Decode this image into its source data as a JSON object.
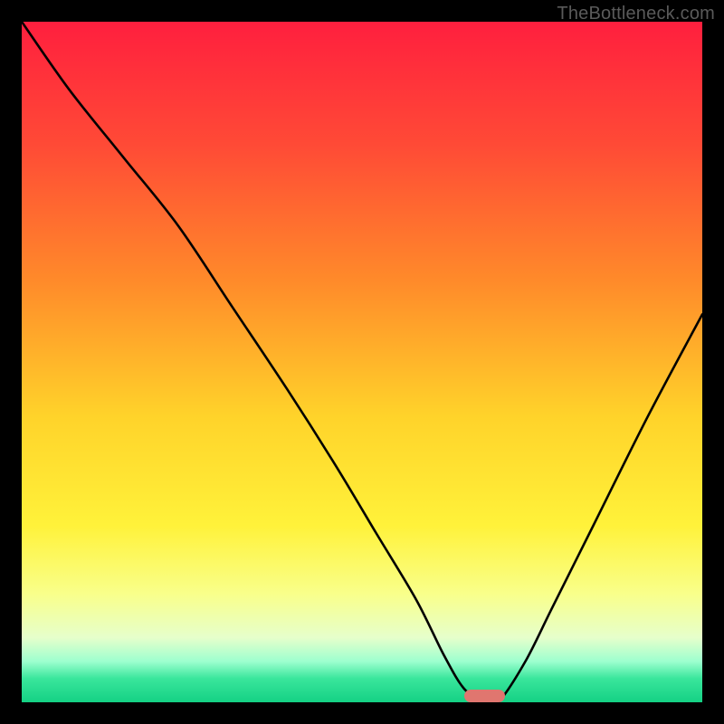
{
  "watermark": "TheBottleneck.com",
  "colors": {
    "accent_marker": "#e0766f",
    "curve_stroke": "#000000",
    "frame_bg": "#000000",
    "gradient_stops": [
      {
        "offset": 0.0,
        "color": "#ff1f3e"
      },
      {
        "offset": 0.18,
        "color": "#ff4a36"
      },
      {
        "offset": 0.38,
        "color": "#ff8a2a"
      },
      {
        "offset": 0.58,
        "color": "#ffd32a"
      },
      {
        "offset": 0.74,
        "color": "#fff23a"
      },
      {
        "offset": 0.84,
        "color": "#f9ff8a"
      },
      {
        "offset": 0.905,
        "color": "#e6ffcb"
      },
      {
        "offset": 0.94,
        "color": "#9dffcf"
      },
      {
        "offset": 0.965,
        "color": "#3ae69c"
      },
      {
        "offset": 1.0,
        "color": "#14d184"
      }
    ]
  },
  "chart_data": {
    "type": "line",
    "title": "",
    "xlabel": "",
    "ylabel": "",
    "xlim": [
      0,
      100
    ],
    "ylim": [
      0,
      100
    ],
    "grid": false,
    "legend": false,
    "series": [
      {
        "name": "bottleneck-curve",
        "x": [
          0,
          7,
          15,
          23,
          31,
          39,
          46,
          52,
          58,
          62,
          65,
          68,
          70,
          74,
          78,
          84,
          92,
          100
        ],
        "values": [
          100,
          90,
          80,
          70,
          58,
          46,
          35,
          25,
          15,
          7,
          2,
          0,
          0,
          6,
          14,
          26,
          42,
          57
        ],
        "note": "Values estimated from plot; y=0 at bottom, y=100 at top. Minimum (optimal point) around x≈67–70."
      }
    ],
    "marker": {
      "x_start": 65,
      "x_end": 71,
      "y": 0,
      "description": "red pill marker at curve minimum near bottom axis"
    }
  },
  "plot_geometry": {
    "inner_left": 24,
    "inner_top": 24,
    "inner_width": 752,
    "inner_height": 752
  }
}
